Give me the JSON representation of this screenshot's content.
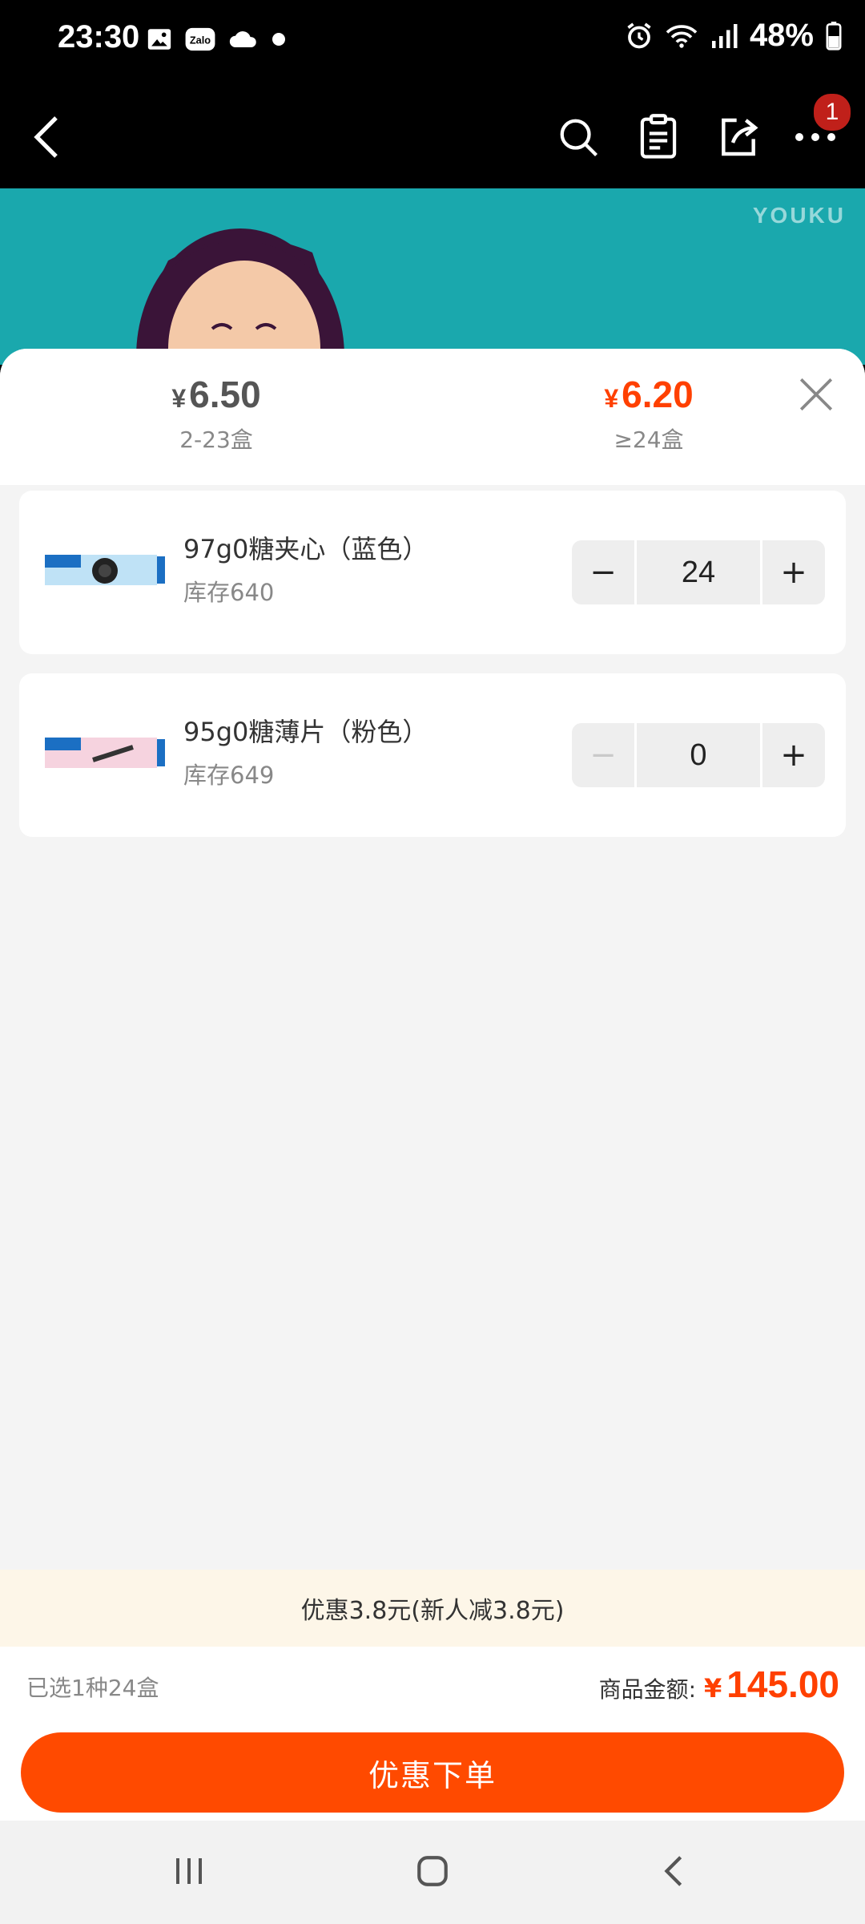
{
  "status_bar": {
    "time": "23:30",
    "battery": "48%",
    "left_icons": [
      "image-icon",
      "zalo-icon",
      "cloud-icon",
      "dot-icon"
    ],
    "right_icons": [
      "alarm-icon",
      "wifi-icon",
      "signal-icon",
      "battery-icon"
    ]
  },
  "top_nav": {
    "more_badge": "1"
  },
  "media": {
    "watermark": "YOUKU"
  },
  "price_tiers": [
    {
      "currency": "¥",
      "price": "6.50",
      "range": "2-23盒",
      "color": "#555555"
    },
    {
      "currency": "¥",
      "price": "6.20",
      "range": "≥24盒",
      "color": "#ff4000"
    }
  ],
  "products": [
    {
      "name": "97g0糖夹心（蓝色）",
      "stock": "库存640",
      "quantity": "24",
      "minus": "−",
      "plus": "+"
    },
    {
      "name": "95g0糖薄片（粉色）",
      "stock": "库存649",
      "quantity": "0",
      "minus": "−",
      "plus": "+"
    }
  ],
  "discount_banner": "优惠3.8元(新人减3.8元)",
  "summary": {
    "selected": "已选1种24盒",
    "total_label": "商品金额:",
    "currency": "¥",
    "total": "145.00"
  },
  "order_button": "优惠下单",
  "colors": {
    "accent": "#ff4a00",
    "price_highlight": "#ff4000",
    "banner_bg": "#fdf6e8"
  }
}
